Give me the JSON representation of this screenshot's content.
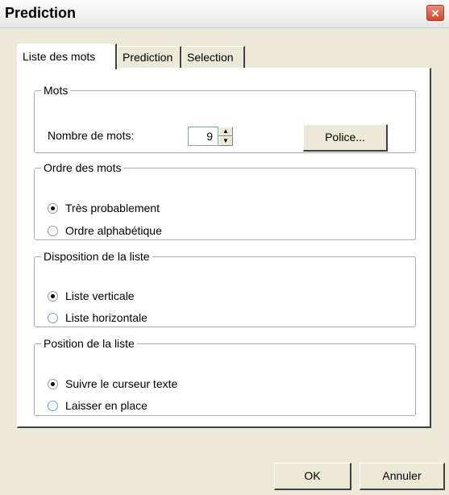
{
  "window": {
    "title": "Prediction",
    "close_icon": "×"
  },
  "tabs": [
    {
      "label": "Liste des mots",
      "active": true
    },
    {
      "label": "Prediction",
      "active": false
    },
    {
      "label": "Selection",
      "active": false
    }
  ],
  "mots": {
    "legend": "Mots",
    "count_label": "Nombre de mots:",
    "count_value": "9",
    "spin_up": "▲",
    "spin_down": "▼",
    "font_button": "Police..."
  },
  "ordre": {
    "legend": "Ordre des mots",
    "options": [
      {
        "label": "Très probablement",
        "checked": true
      },
      {
        "label": "Ordre alphabétique",
        "checked": false
      }
    ]
  },
  "disposition": {
    "legend": "Disposition de la liste",
    "options": [
      {
        "label": "Liste verticale",
        "checked": true
      },
      {
        "label": "Liste horizontale",
        "checked": false
      }
    ]
  },
  "position": {
    "legend": "Position de la liste",
    "options": [
      {
        "label": "Suivre le curseur texte",
        "checked": true
      },
      {
        "label": "Laisser en place",
        "checked": false
      }
    ]
  },
  "footer": {
    "ok_label": "OK",
    "cancel_label": "Annuler"
  }
}
